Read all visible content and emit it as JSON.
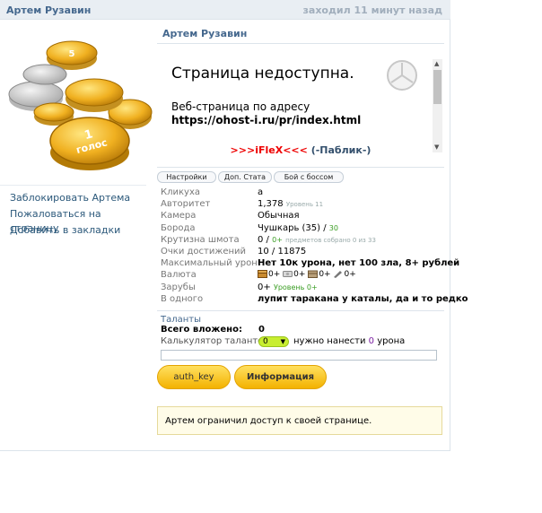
{
  "topbar": {
    "name": "Артем Рузавин",
    "last_seen": "заходил 11 минут назад"
  },
  "sidebar": {
    "links": [
      {
        "label": "Заблокировать Артема"
      },
      {
        "label": "Пожаловаться на страницу"
      },
      {
        "label": "Добавить в закладки"
      }
    ]
  },
  "profile": {
    "name": "Артем Рузавин"
  },
  "embed": {
    "title": "Страница недоступна.",
    "line1": "Веб-страница по адресу",
    "line2": "https://ohost-i.ru/pr/index.html"
  },
  "slogan": {
    "red": ">>>iFleX<<<",
    "dark": "(-Паблик-)"
  },
  "tabs": [
    {
      "label": "Настройки"
    },
    {
      "label": "Доп. Стата"
    },
    {
      "label": "Бой с боссом"
    }
  ],
  "stats": {
    "klikukha": {
      "key": "Кликуха",
      "value": "а"
    },
    "avtoritet": {
      "key": "Авторитет",
      "value": "1,378",
      "note": "Уровень 11"
    },
    "kamera": {
      "key": "Камера",
      "value": "Обычная"
    },
    "boroda": {
      "key": "Борода",
      "value": "Чушкарь (35) /",
      "extra": "30"
    },
    "krutizna": {
      "key": "Крутизна шмота",
      "value": "0 /",
      "plus": "0+",
      "note": "предметов собрано 0 из 33"
    },
    "ochki": {
      "key": "Очки достижений",
      "value": "10 / 11875"
    },
    "uron": {
      "key": "Максимальный урон",
      "value": "Нет 10к урона, нет 100 зла, 8+ рублей"
    },
    "valuta": {
      "key": "Валюта",
      "items": [
        "0+",
        "0+",
        "0+",
        "0+"
      ]
    },
    "zaruby": {
      "key": "Зарубы",
      "value": "0+",
      "note": "Уровень 0+"
    },
    "vodnogo": {
      "key": "В одного",
      "value": "лупит таракана у каталы, да и то редко"
    }
  },
  "talents": {
    "header": "Таланты",
    "total_label": "Всего вложено:",
    "total_value": "0",
    "calc_label": "Калькулятор талантов :",
    "select_value": "0",
    "need_pre": "нужно нанести",
    "need_num": "0",
    "need_post": "урона"
  },
  "buttons": {
    "auth": "auth_key",
    "info": "Информация"
  },
  "notice": "Артем ограничил доступ к своей странице.",
  "colors": {
    "link": "#2b587a",
    "header": "#45688e",
    "button": "#f3b200",
    "select": "#c8ee30"
  }
}
